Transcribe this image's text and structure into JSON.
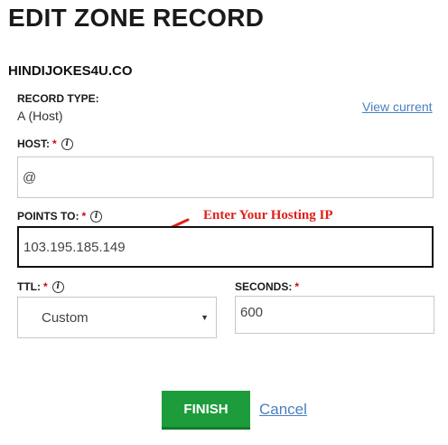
{
  "page": {
    "title": "EDIT ZONE RECORD",
    "domain": "HINDIJOKES4U.CO"
  },
  "record_type": {
    "label": "RECORD TYPE:",
    "value": "A (Host)",
    "view_current_link": "View current"
  },
  "host": {
    "label": "HOST:",
    "required_mark": "*",
    "value": "@"
  },
  "points_to": {
    "label": "POINTS TO:",
    "required_mark": "*",
    "value": "103.195.185.149"
  },
  "annotation": {
    "text": "Enter Your Hosting IP",
    "color": "#e0201b"
  },
  "ttl": {
    "label": "TTL:",
    "required_mark": "*",
    "selected": "Custom"
  },
  "seconds": {
    "label": "SECONDS:",
    "required_mark": "*",
    "value": "600"
  },
  "actions": {
    "finish_label": "FINISH",
    "cancel_label": "Cancel",
    "finish_color": "#1d9c3c",
    "link_color": "#4a7fc1"
  },
  "icons": {
    "info": "i"
  }
}
